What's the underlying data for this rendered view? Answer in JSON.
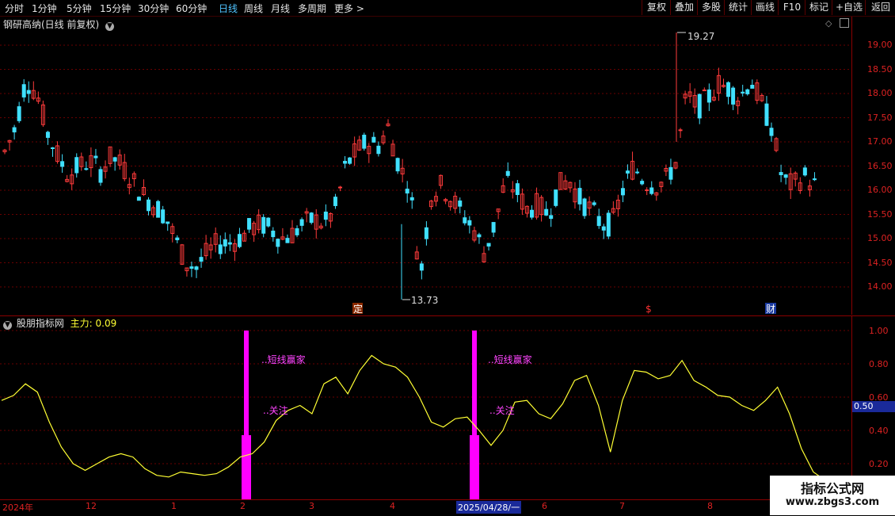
{
  "toolbar": {
    "periods": [
      "分时",
      "1分钟",
      "5分钟",
      "15分钟",
      "30分钟",
      "60分钟",
      "日线",
      "周线",
      "月线",
      "多周期",
      "更多 >"
    ],
    "active_period": "日线",
    "buttons": [
      "复权",
      "叠加",
      "多股",
      "统计",
      "画线",
      "F10",
      "标记",
      "+自选",
      "返回"
    ]
  },
  "main": {
    "title": "钢研高纳(日线 前复权)",
    "high_label": "19.27",
    "low_label": "13.73",
    "y_axis": [
      "19.00",
      "18.50",
      "18.00",
      "17.50",
      "17.00",
      "16.50",
      "16.00",
      "15.50",
      "15.00",
      "14.50",
      "14.00"
    ],
    "markers": [
      "定",
      "$",
      "财"
    ],
    "colors": {
      "up": "#ff3b3b",
      "down": "#40e0ff",
      "grid": "#7a0000"
    }
  },
  "indicator": {
    "name": "股朋指标网",
    "main_label": "主力:",
    "main_value": "0.09",
    "y_axis": [
      "1.00",
      "0.80",
      "0.60",
      "0.40",
      "0.20"
    ],
    "current_value": "0.50",
    "signal_text_1": "..短线赢家",
    "signal_text_2": "..关注",
    "colors": {
      "line": "#ffff33",
      "signal": "#ff00ff"
    }
  },
  "dates": {
    "labels": [
      "2024年",
      "12",
      "1",
      "2",
      "3",
      "4",
      "6",
      "7",
      "8"
    ],
    "cursor_date": "2025/04/28/一"
  },
  "watermark": {
    "line1": "指标公式网",
    "line2": "www.zbgs3.com"
  }
}
